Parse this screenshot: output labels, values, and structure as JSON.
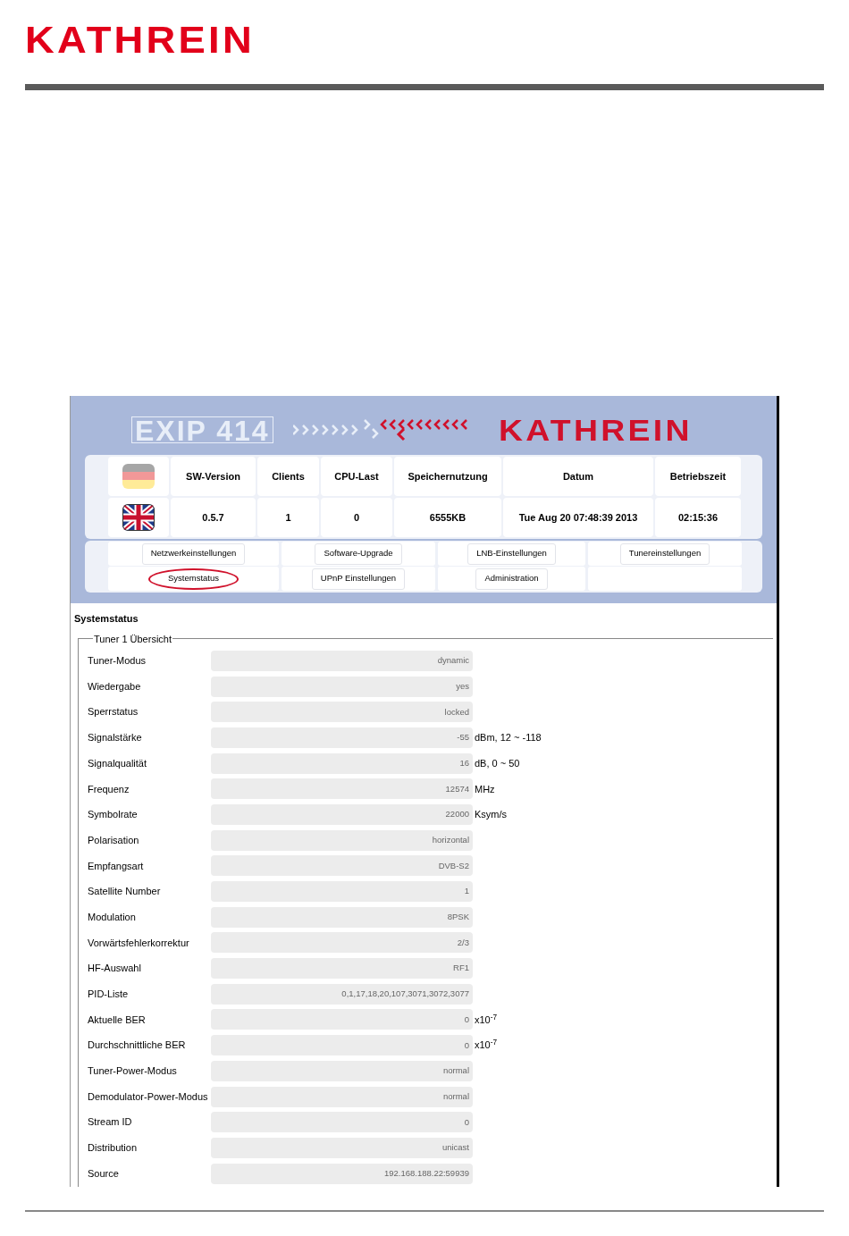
{
  "page_logo": "KATHREIN",
  "screen": {
    "product_logo": "EXIP 414",
    "brand_logo": "KATHREIN",
    "languages": [
      {
        "kind": "german",
        "selected": false
      },
      {
        "kind": "english",
        "selected": true
      }
    ],
    "status_table": {
      "columns": [
        "SW-Version",
        "Clients",
        "CPU-Last",
        "Speichernutzung",
        "Datum",
        "Betriebszeit"
      ],
      "values": [
        "0.5.7",
        "1",
        "0",
        "6555KB",
        "Tue Aug 20 07:48:39 2013",
        "02:15:36"
      ]
    },
    "nav": [
      [
        {
          "label": "Netzwerkeinstellungen",
          "highlighted": false
        },
        {
          "label": "Software-Upgrade",
          "highlighted": false
        },
        {
          "label": "LNB-Einstellungen",
          "highlighted": false
        },
        {
          "label": "Tunereinstellungen",
          "highlighted": false
        }
      ],
      [
        {
          "label": "Systemstatus",
          "highlighted": true
        },
        {
          "label": "UPnP Einstellungen",
          "highlighted": false
        },
        {
          "label": "Administration",
          "highlighted": false
        }
      ]
    ],
    "section_title": "Systemstatus",
    "fieldset": {
      "legend": "Tuner 1 Übersicht",
      "rows": [
        {
          "label": "Tuner-Modus",
          "value": "dynamic"
        },
        {
          "label": "Wiedergabe",
          "value": "yes"
        },
        {
          "label": "Sperrstatus",
          "value": "locked"
        },
        {
          "label": "Signalstärke",
          "value": "-55",
          "unit": "dBm, 12 ~ -118"
        },
        {
          "label": "Signalqualität",
          "value": "16",
          "unit": "dB, 0 ~ 50"
        },
        {
          "label": "Frequenz",
          "value": "12574",
          "unit": "MHz"
        },
        {
          "label": "Symbolrate",
          "value": "22000",
          "unit": "Ksym/s"
        },
        {
          "label": "Polarisation",
          "value": "horizontal"
        },
        {
          "label": "Empfangsart",
          "value": "DVB-S2"
        },
        {
          "label": "Satellite Number",
          "value": "1"
        },
        {
          "label": "Modulation",
          "value": "8PSK"
        },
        {
          "label": "Vorwärtsfehlerkorrektur",
          "value": "2/3"
        },
        {
          "label": "HF-Auswahl",
          "value": "RF1"
        },
        {
          "label": "PID-Liste",
          "value": "0,1,17,18,20,107,3071,3072,3077"
        },
        {
          "label": "Aktuelle BER",
          "value": "0",
          "unit": "x10$^{-7}$"
        },
        {
          "label": "Durchschnittliche BER",
          "value": "0",
          "unit": "x10$^{-7}$"
        },
        {
          "label": "Tuner-Power-Modus",
          "value": "normal"
        },
        {
          "label": "Demodulator-Power-Modus",
          "value": "normal"
        },
        {
          "label": "Stream ID",
          "value": "0"
        },
        {
          "label": "Distribution",
          "value": "unicast"
        },
        {
          "label": "Source",
          "value": "192.168.188.22:59939"
        }
      ]
    }
  }
}
